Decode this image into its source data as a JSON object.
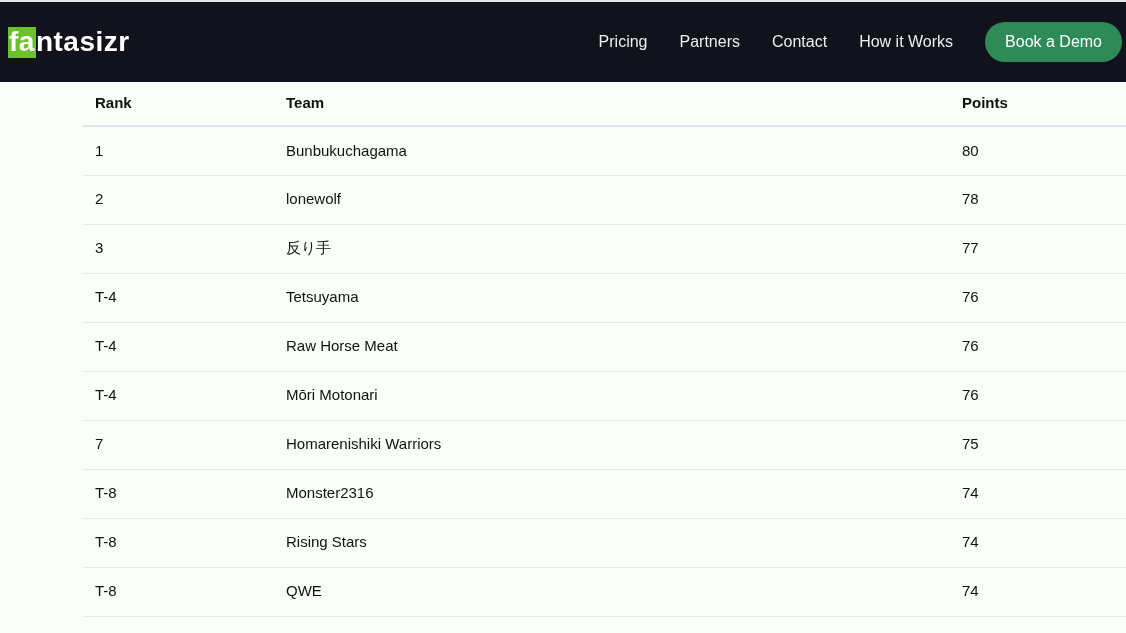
{
  "logo": {
    "highlight": "fa",
    "rest": "ntasizr"
  },
  "nav": {
    "links": [
      "Pricing",
      "Partners",
      "Contact",
      "How it Works"
    ],
    "button": "Book a Demo"
  },
  "table": {
    "columns": [
      "Rank",
      "Team",
      "Points"
    ],
    "rows": [
      [
        "1",
        "Bunbukuchagama",
        "80"
      ],
      [
        "2",
        "lonewolf",
        "78"
      ],
      [
        "3",
        "反り手",
        "77"
      ],
      [
        "T-4",
        "Tetsuyama",
        "76"
      ],
      [
        "T-4",
        "Raw Horse Meat",
        "76"
      ],
      [
        "T-4",
        "Mōri Motonari",
        "76"
      ],
      [
        "7",
        "Homarenishiki Warriors",
        "75"
      ],
      [
        "T-8",
        "Monster2316",
        "74"
      ],
      [
        "T-8",
        "Rising Stars",
        "74"
      ],
      [
        "T-8",
        "QWE",
        "74"
      ]
    ]
  }
}
